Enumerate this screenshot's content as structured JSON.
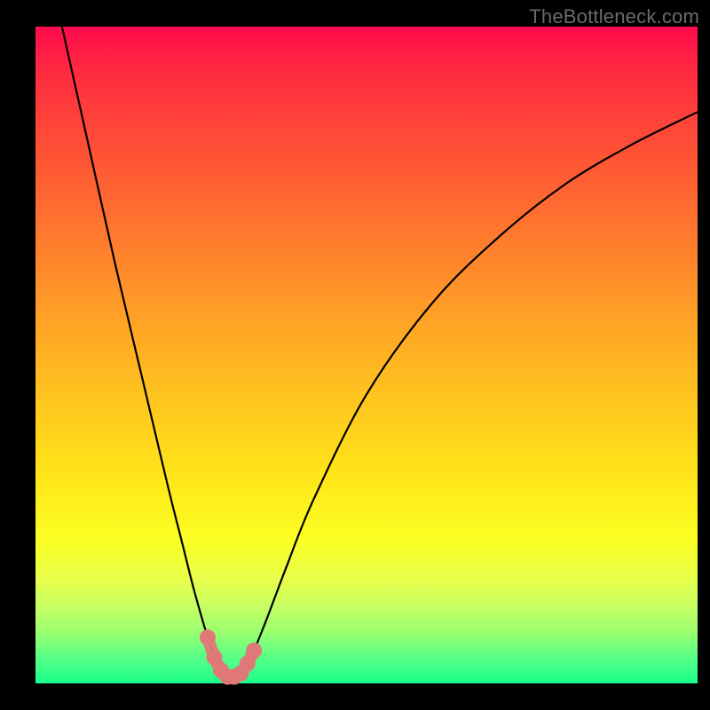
{
  "watermark": "TheBottleneck.com",
  "chart_data": {
    "type": "line",
    "title": "",
    "xlabel": "",
    "ylabel": "",
    "xlim": [
      0,
      100
    ],
    "ylim": [
      0,
      100
    ],
    "grid": false,
    "legend": false,
    "series": [
      {
        "name": "bottleneck-curve",
        "x": [
          4,
          8,
          12,
          16,
          20,
          22,
          24,
          26,
          27,
          28,
          29,
          30,
          31,
          32,
          33,
          35,
          38,
          42,
          50,
          60,
          70,
          80,
          90,
          100
        ],
        "y": [
          100,
          82,
          64,
          47,
          30,
          22,
          14,
          7,
          4,
          2,
          1,
          1,
          1.5,
          3,
          5,
          10,
          18,
          28,
          44,
          58,
          68,
          76,
          82,
          87
        ]
      },
      {
        "name": "highlight-dots",
        "type": "scatter",
        "x": [
          26,
          27,
          28,
          29,
          30,
          31,
          32,
          33
        ],
        "y": [
          7,
          4,
          2,
          1,
          1,
          1.5,
          3,
          5
        ]
      }
    ],
    "colors": {
      "curve": "#000000",
      "dots": "#e17878"
    }
  }
}
